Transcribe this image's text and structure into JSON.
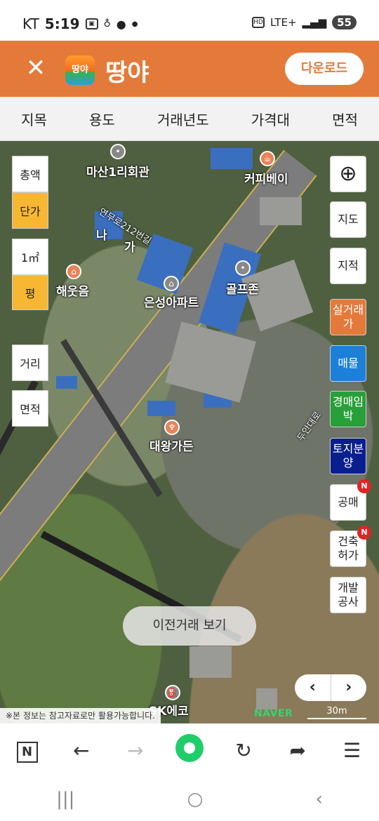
{
  "status_bar": {
    "carrier": "KT",
    "time": "5:19",
    "network": "LTE+",
    "battery": "55"
  },
  "header": {
    "logo_icon_text": "땅야",
    "app_name": "땅야",
    "download_label": "다운로드"
  },
  "filter_tabs": [
    "지목",
    "용도",
    "거래년도",
    "가격대",
    "면적"
  ],
  "left_controls": {
    "total": "총액",
    "unit_price": "단가",
    "sqm": "1㎡",
    "pyeong": "평",
    "distance": "거리",
    "area": "면적"
  },
  "right_controls": {
    "map": "지도",
    "cadastral": "지적",
    "real_deal": "실거래가",
    "listing": "매물",
    "auction_lease": "경매임박",
    "land_sale": "토지분양",
    "public_sale": "공매",
    "building_permit": "건축허가",
    "dev_construction": "개발공사",
    "new_badge": "N"
  },
  "map_labels": {
    "masan_hall": "마산1리회관",
    "coffee_bay": "커피베이",
    "road_name": "연무로212번길",
    "na": "나",
    "ga": "가",
    "haeut": "해웃음",
    "eunseong": "은성아파트",
    "golfzone": "골프존",
    "daewang": "대왕가든",
    "road_main": "두안대로",
    "sk": "SK에코"
  },
  "map_overlay": {
    "prev_deals": "이전거래 보기",
    "pager_prev": "‹",
    "pager_next": "›",
    "disclaimer": "※본 정보는 참고자료로만 활용가능합니다.",
    "naver": "NAVER",
    "scale": "30m"
  },
  "nav_bar": {
    "recent": "|||",
    "home": "○",
    "back": "‹"
  }
}
